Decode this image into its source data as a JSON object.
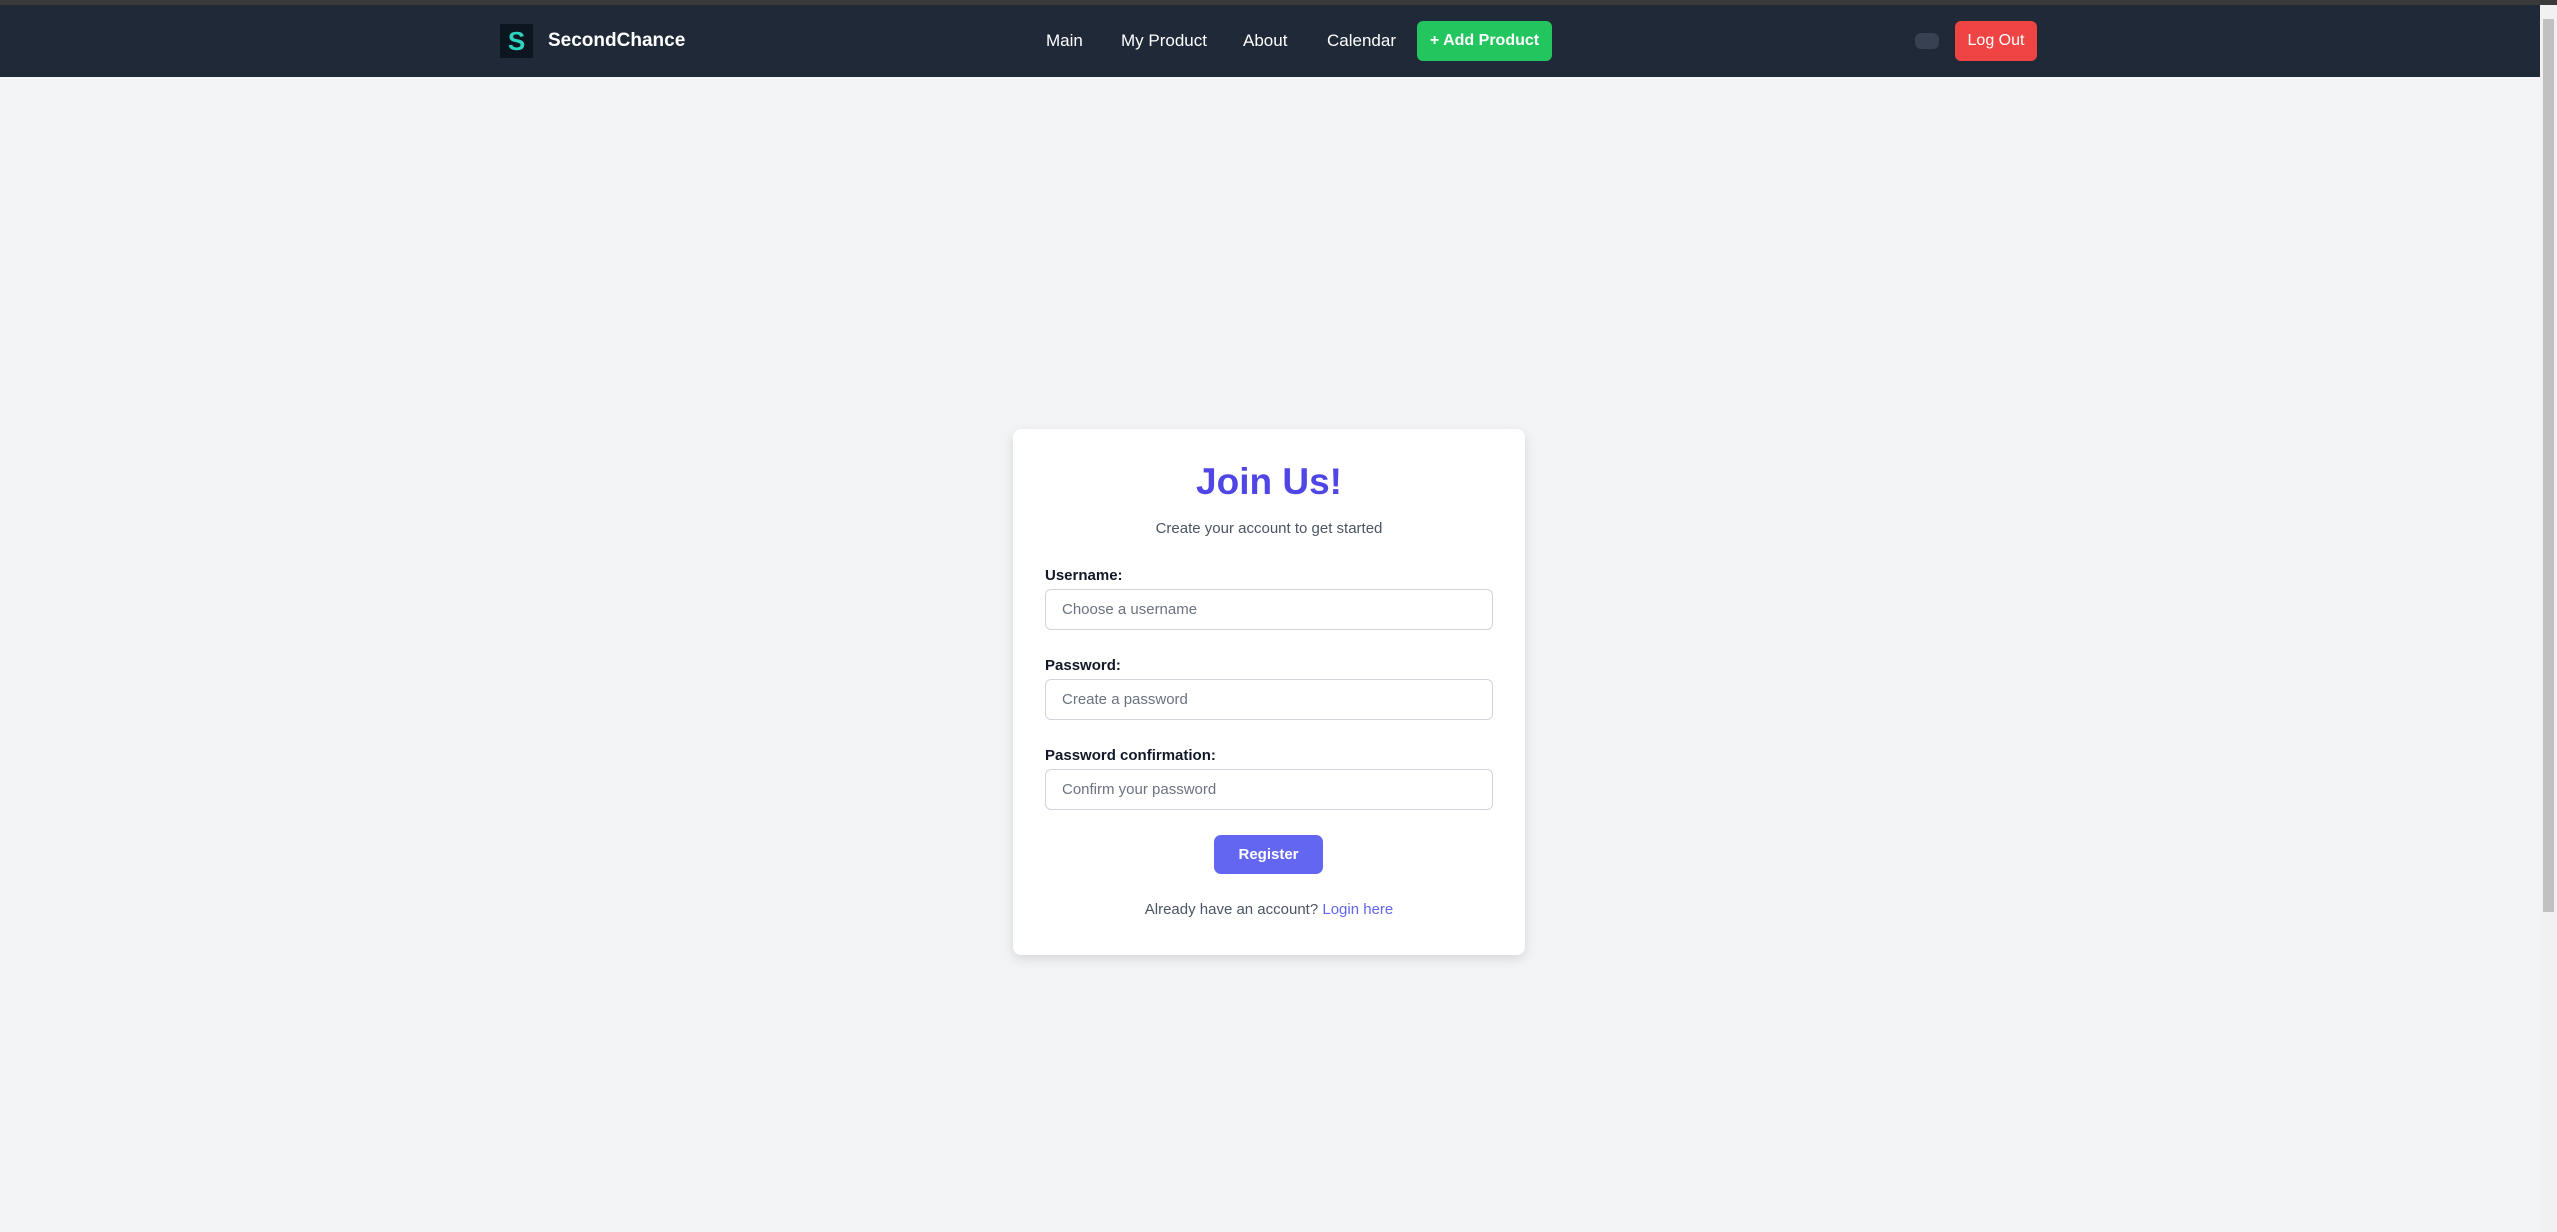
{
  "nav": {
    "brand": "SecondChance",
    "logo_icon": "logo-s-icon",
    "links": [
      "Main",
      "My Product",
      "About",
      "Calendar"
    ],
    "add_product": "+ Add Product",
    "logout": "Log Out"
  },
  "form": {
    "title": "Join Us!",
    "subtitle": "Create your account to get started",
    "fields": [
      {
        "label": "Username:",
        "placeholder": "Choose a username"
      },
      {
        "label": "Password:",
        "placeholder": "Create a password"
      },
      {
        "label": "Password confirmation:",
        "placeholder": "Confirm your password"
      }
    ],
    "submit": "Register",
    "footer_text": "Already have an account?",
    "footer_link": "Login here"
  },
  "colors": {
    "accent": "#4f46e5",
    "button": "#6366f1",
    "add": "#22c55e",
    "logout": "#ef4444",
    "navbar": "#1f2937"
  }
}
